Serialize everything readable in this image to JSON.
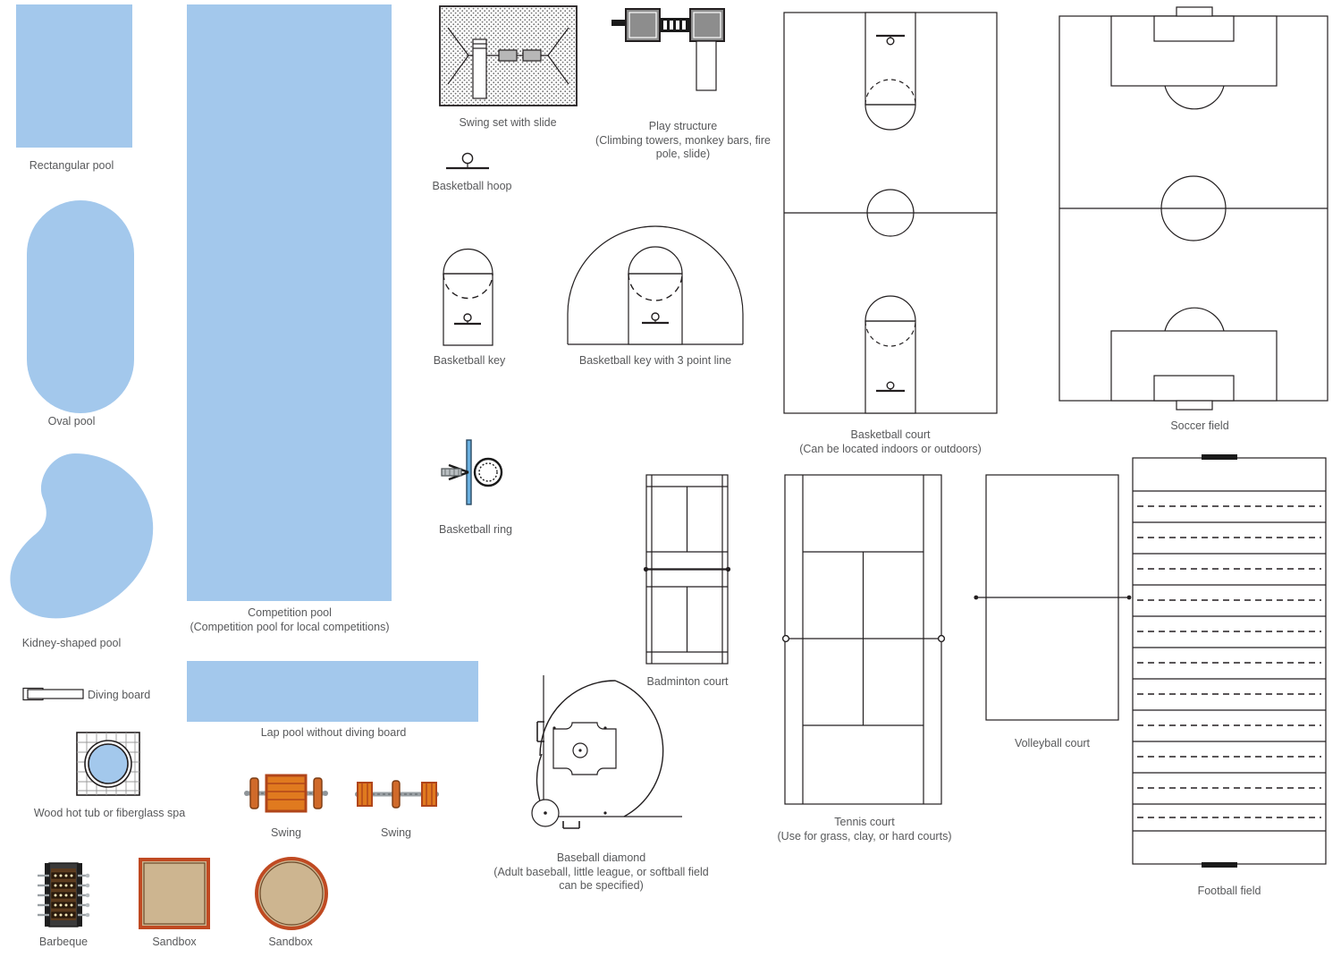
{
  "page": {
    "title": "Sport Fields and Recreation Design Elements",
    "background": "#ffffff",
    "pool_color": "#a3c8ec",
    "line_color": "#231f20",
    "label_color": "#58595b",
    "sand_color": "#cdb590",
    "sand_border_color": "#c04a22"
  },
  "shapes": [
    {
      "id": "rectangular-pool",
      "label": "Rectangular pool"
    },
    {
      "id": "oval-pool",
      "label": "Oval pool"
    },
    {
      "id": "kidney-pool",
      "label": "Kidney-shaped pool"
    },
    {
      "id": "diving-board",
      "label": "Diving board"
    },
    {
      "id": "hot-tub",
      "label": "Wood hot tub or fiberglass spa"
    },
    {
      "id": "barbeque",
      "label": "Barbeque"
    },
    {
      "id": "sandbox-square",
      "label": "Sandbox"
    },
    {
      "id": "sandbox-round",
      "label": "Sandbox"
    },
    {
      "id": "competition-pool",
      "label": "Competition pool\n(Competition pool for local competitions)"
    },
    {
      "id": "lap-pool",
      "label": "Lap pool without diving board"
    },
    {
      "id": "swing-wide",
      "label": "Swing"
    },
    {
      "id": "swing-narrow",
      "label": "Swing"
    },
    {
      "id": "swing-set-slide",
      "label": "Swing set with slide"
    },
    {
      "id": "basketball-hoop",
      "label": "Basketball hoop"
    },
    {
      "id": "basketball-key",
      "label": "Basketball key"
    },
    {
      "id": "basketball-key-3pt",
      "label": "Basketball key with 3 point line"
    },
    {
      "id": "basketball-ring",
      "label": "Basketball ring"
    },
    {
      "id": "play-structure",
      "label": "Play structure\n(Climbing towers, monkey bars, fire\npole, slide)"
    },
    {
      "id": "badminton-court",
      "label": "Badminton court"
    },
    {
      "id": "baseball-diamond",
      "label": "Baseball diamond\n(Adult baseball, little league, or softball field\ncan be specified)"
    },
    {
      "id": "basketball-court",
      "label": "Basketball court\n(Can be located indoors or outdoors)"
    },
    {
      "id": "tennis-court",
      "label": "Tennis court\n(Use for grass, clay, or hard courts)"
    },
    {
      "id": "volleyball-court",
      "label": "Volleyball court"
    },
    {
      "id": "soccer-field",
      "label": "Soccer field"
    },
    {
      "id": "football-field",
      "label": "Football field"
    }
  ],
  "labels": {
    "rectangular_pool": "Rectangular pool",
    "oval_pool": "Oval pool",
    "kidney_pool": "Kidney-shaped pool",
    "diving_board": "Diving board",
    "hot_tub": "Wood hot tub or fiberglass spa",
    "barbeque": "Barbeque",
    "sandbox_square": "Sandbox",
    "sandbox_round": "Sandbox",
    "competition_pool": "Competition pool\n(Competition pool for local competitions)",
    "lap_pool": "Lap pool without diving board",
    "swing_wide": "Swing",
    "swing_narrow": "Swing",
    "swing_set_slide": "Swing set with slide",
    "basketball_hoop": "Basketball hoop",
    "basketball_key": "Basketball key",
    "basketball_key_3pt": "Basketball key with 3 point line",
    "basketball_ring": "Basketball ring",
    "play_structure": "Play structure\n(Climbing towers, monkey bars, fire\npole, slide)",
    "badminton_court": "Badminton court",
    "baseball_diamond": "Baseball diamond\n(Adult baseball, little league, or softball field\ncan be specified)",
    "basketball_court": "Basketball court\n(Can be located indoors or outdoors)",
    "tennis_court": "Tennis court\n(Use for grass, clay, or hard courts)",
    "volleyball_court": "Volleyball court",
    "soccer_field": "Soccer field",
    "football_field": "Football field"
  }
}
